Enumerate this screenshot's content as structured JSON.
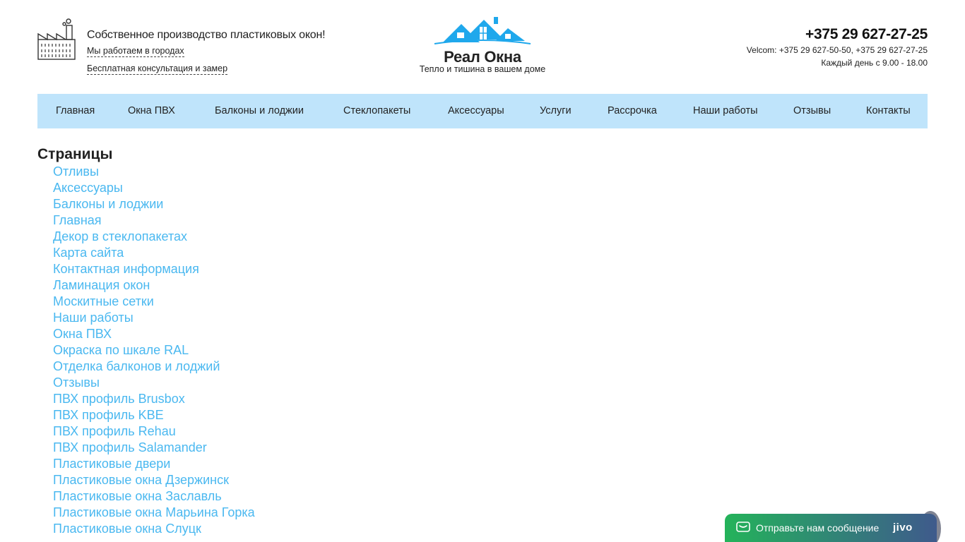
{
  "header": {
    "tagline": "Собственное производство пластиковых окон!",
    "cities_link": "Мы работаем в городах",
    "consult_link": "Бесплатная консультация и замер",
    "logo_name": "Реал Окна",
    "logo_slogan": "Тепло и тишина в вашем доме",
    "phone_main": "+375 29 627-27-25",
    "phone_velcom": "Velcom: +375 29 627-50-50, +375 29 627-27-25",
    "hours": "Каждый день с 9.00 - 18.00"
  },
  "nav": {
    "items": [
      {
        "label": "Главная"
      },
      {
        "label": "Окна ПВХ"
      },
      {
        "label": "Балконы и лоджии"
      },
      {
        "label": "Стеклопакеты"
      },
      {
        "label": "Аксессуары"
      },
      {
        "label": "Услуги"
      },
      {
        "label": "Рассрочка"
      },
      {
        "label": "Наши работы"
      },
      {
        "label": "Отзывы"
      },
      {
        "label": "Контакты"
      }
    ]
  },
  "pages": {
    "title": "Страницы",
    "items": [
      "Отливы",
      "Аксессуары",
      "Балконы и лоджии",
      "Главная",
      "Декор в стеклопакетах",
      "Карта сайта",
      "Контактная информация",
      "Ламинация окон",
      "Москитные сетки",
      "Наши работы",
      "Окна ПВХ",
      "Окраска по шкале RAL",
      "Отделка балконов и лоджий",
      "Отзывы",
      "ПВХ профиль Brusbox",
      "ПВХ профиль KBE",
      "ПВХ профиль Rehau",
      "ПВХ профиль Salamander",
      "Пластиковые двери",
      "Пластиковые окна Дзержинск",
      "Пластиковые окна Заславль",
      "Пластиковые окна Марьина Горка",
      "Пластиковые окна Слуцк"
    ]
  },
  "jivo": {
    "message": "Отправьте нам сообщение",
    "brand": "jivo"
  },
  "colors": {
    "nav_bg": "#bfe4fb",
    "link": "#4ab8f0",
    "logo_house": "#1fa8ec"
  },
  "icons": {
    "factory": "factory-icon",
    "logo": "house-logo-icon",
    "chat": "chat-bubble-icon"
  }
}
